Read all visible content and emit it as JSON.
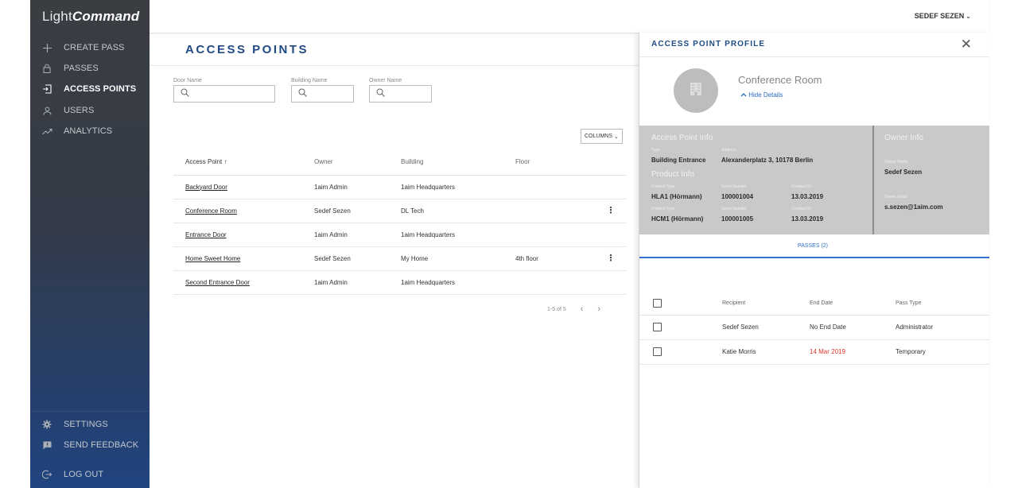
{
  "app": {
    "logo_light": "Light",
    "logo_bold": "Command"
  },
  "sidebar": {
    "items": [
      {
        "label": "CREATE PASS",
        "icon": "plus-icon"
      },
      {
        "label": "PASSES",
        "icon": "lock-icon"
      },
      {
        "label": "ACCESS POINTS",
        "icon": "door-enter-icon",
        "active": true
      },
      {
        "label": "USERS",
        "icon": "user-icon"
      },
      {
        "label": "ANALYTICS",
        "icon": "trend-icon"
      }
    ],
    "bottom": [
      {
        "label": "SETTINGS",
        "icon": "gear-icon"
      },
      {
        "label": "SEND FEEDBACK",
        "icon": "feedback-icon"
      },
      {
        "label": "LOG OUT",
        "icon": "logout-icon"
      }
    ]
  },
  "topbar": {
    "user_name": "SEDEF SEZEN",
    "caret": "⌄"
  },
  "main": {
    "title": "ACCESS POINTS",
    "filters": [
      {
        "label": "Door Name",
        "placeholder": ""
      },
      {
        "label": "Building Name",
        "placeholder": ""
      },
      {
        "label": "Owner Name",
        "placeholder": ""
      }
    ],
    "columns_button": "COLUMNS",
    "table": {
      "headers": [
        "Access Point",
        "Owner",
        "Building",
        "Floor"
      ],
      "sort_arrow": "↑",
      "rows": [
        {
          "name": "Backyard Door",
          "owner": "1aim Admin",
          "building": "1aim Headquarters",
          "floor": "",
          "menu": false
        },
        {
          "name": "Conference Room",
          "owner": "Sedef Sezen",
          "building": "DL Tech",
          "floor": "",
          "menu": true
        },
        {
          "name": "Entrance Door",
          "owner": "1aim Admin",
          "building": "1aim Headquarters",
          "floor": "",
          "menu": false
        },
        {
          "name": "Home Sweet Home",
          "owner": "Sedef Sezen",
          "building": "My Home",
          "floor": "4th floor",
          "menu": true
        },
        {
          "name": "Second Entrance Door",
          "owner": "1aim Admin",
          "building": "1aim Headquarters",
          "floor": "",
          "menu": false
        }
      ]
    },
    "pagination": {
      "text": "1-5 of 5",
      "prev": "‹",
      "next": "›"
    }
  },
  "panel": {
    "title": "ACCESS POINT PROFILE",
    "close": "✕",
    "name": "Conference Room",
    "hide_details": "Hide Details",
    "access_info": {
      "heading": "Access Point Info",
      "type_label": "Type",
      "type": "Building Entrance",
      "address_label": "Address",
      "address": "Alexanderplatz 3, 10178 Berlin"
    },
    "product_info": {
      "heading": "Product Info",
      "products": [
        {
          "type_label": "Product Type",
          "type": "HLA1 (Hörmann)",
          "serial_label": "Serial Number",
          "serial": "100001004",
          "created_label": "Created On",
          "created": "13.03.2019"
        },
        {
          "type_label": "Product Type",
          "type": "HCM1 (Hörmann)",
          "serial_label": "Serial Number",
          "serial": "100001005",
          "created_label": "Created On",
          "created": "13.03.2019"
        }
      ]
    },
    "owner_info": {
      "heading": "Owner Info",
      "name_label": "Owner Name",
      "name": "Sedef Sezen",
      "email_label": "Owner Email",
      "email": "s.sezen@1aim.com"
    },
    "tab": "PASSES (2)",
    "passes": {
      "headers": [
        "Recipient",
        "End Date",
        "Pass Type"
      ],
      "rows": [
        {
          "recipient": "Sedef Sezen",
          "end_date": "No End Date",
          "pass_type": "Administrator",
          "expired": false
        },
        {
          "recipient": "Katie Morris",
          "end_date": "14 Mar 2019",
          "pass_type": "Temporary",
          "expired": true
        }
      ]
    }
  },
  "colors": {
    "accent": "#1f4a86",
    "link": "#2f6fcf",
    "danger": "#e0342c",
    "sidebar_top": "#3a3d42",
    "sidebar_bottom": "#1f4480"
  }
}
